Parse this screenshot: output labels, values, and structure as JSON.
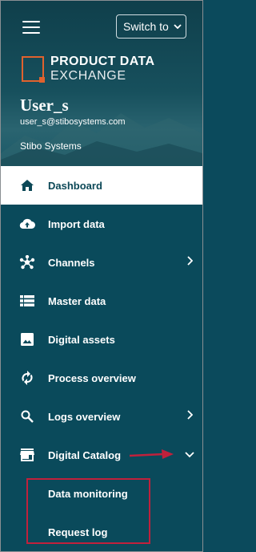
{
  "header": {
    "switch_label": "Switch to",
    "logo_line1": "PRODUCT DATA",
    "logo_line2": "EXCHANGE",
    "user_name": "User_s",
    "user_email": "user_s@stibosystems.com",
    "company": "Stibo Systems"
  },
  "nav": {
    "items": [
      {
        "label": "Dashboard",
        "icon": "home-icon",
        "active": true
      },
      {
        "label": "Import data",
        "icon": "cloud-upload-icon"
      },
      {
        "label": "Channels",
        "icon": "hub-icon",
        "expandable": true
      },
      {
        "label": "Master data",
        "icon": "list-icon"
      },
      {
        "label": "Digital assets",
        "icon": "image-icon"
      },
      {
        "label": "Process overview",
        "icon": "sync-icon"
      },
      {
        "label": "Logs overview",
        "icon": "search-icon",
        "expandable": true
      },
      {
        "label": "Digital Catalog",
        "icon": "storefront-icon",
        "expanded": true
      }
    ],
    "sub_items": [
      "Data monitoring",
      "Request log"
    ]
  },
  "colors": {
    "sidebar_bg": "#0a4a5b",
    "active_bg": "#ffffff",
    "active_text": "#0c4857",
    "logo_accent": "#e0622e",
    "annotation": "#c0213c"
  }
}
